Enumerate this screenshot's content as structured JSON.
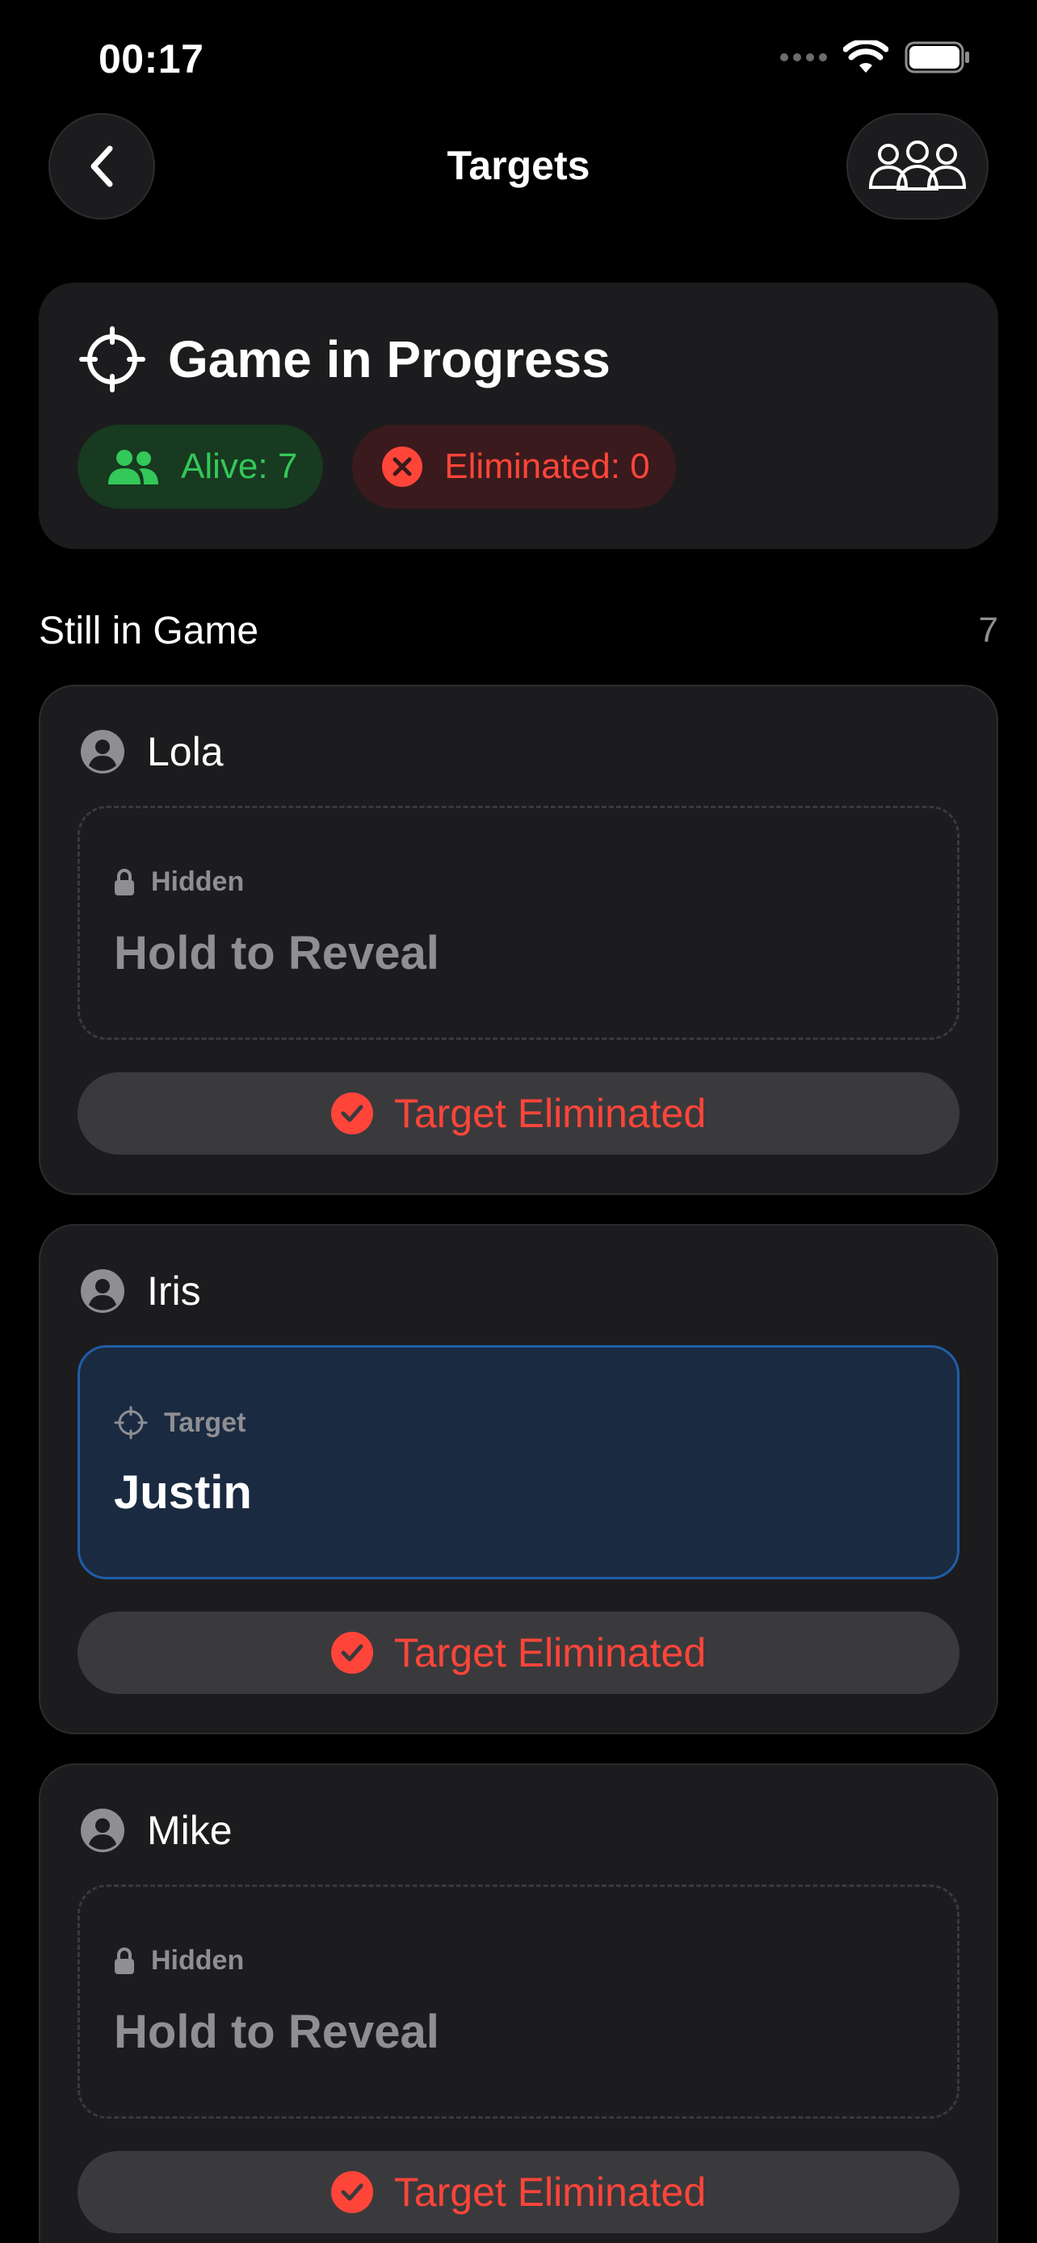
{
  "status_bar": {
    "time": "00:17"
  },
  "nav": {
    "title": "Targets"
  },
  "summary": {
    "title": "Game in Progress",
    "alive_label": "Alive: 7",
    "eliminated_label": "Eliminated: 0"
  },
  "section": {
    "title": "Still in Game",
    "count": "7"
  },
  "players": [
    {
      "name": "Lola",
      "box_label": "Hidden",
      "box_value": "Hold to Reveal",
      "button_label": "Target Eliminated"
    },
    {
      "name": "Iris",
      "box_label": "Target",
      "box_value": "Justin",
      "button_label": "Target Eliminated"
    },
    {
      "name": "Mike",
      "box_label": "Hidden",
      "box_value": "Hold to Reveal",
      "button_label": "Target Eliminated"
    }
  ],
  "colors": {
    "background": "#000000",
    "card": "#1c1c1e",
    "alive_green": "#34c759",
    "eliminated_red": "#ff453a",
    "revealed_blue": "#1a2a40"
  },
  "icons": {
    "back": "chevron-left-icon",
    "group": "group-icon",
    "crosshair": "crosshair-icon",
    "people": "people-icon",
    "x_circle": "x-circle-icon",
    "person": "person-circle-icon",
    "lock": "lock-icon",
    "check": "checkmark-circle-icon"
  }
}
